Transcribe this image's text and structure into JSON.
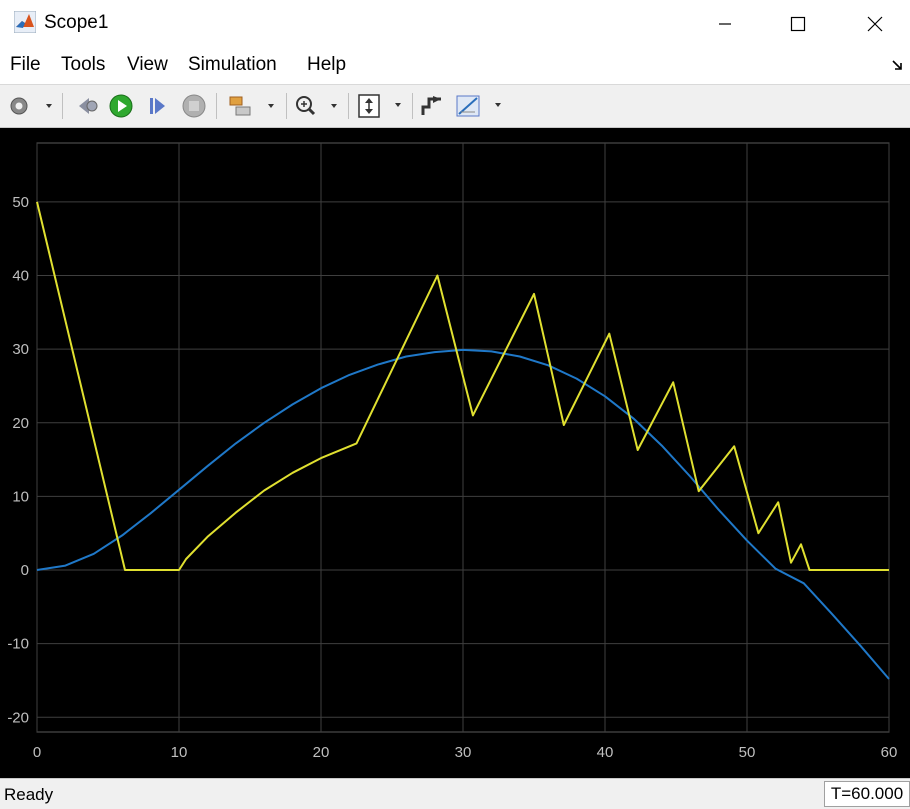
{
  "window": {
    "title": "Scope1"
  },
  "menu": {
    "file": "File",
    "tools": "Tools",
    "view": "View",
    "simulation": "Simulation",
    "help": "Help"
  },
  "toolbar": {
    "icons": [
      "gear-icon",
      "step-back-icon",
      "run-icon",
      "step-forward-icon",
      "stop-icon",
      "layout-icon",
      "zoom-icon",
      "fit-axes-icon",
      "triggers-icon",
      "measure-icon"
    ]
  },
  "status": {
    "text": "Ready",
    "time": "T=60.000"
  },
  "colors": {
    "plot_bg": "#000000",
    "grid": "#3f3f3f",
    "axis_text": "#bfbfbf",
    "series_blue": "#1f78c8",
    "series_yellow": "#e0e030"
  },
  "chart_data": {
    "type": "line",
    "xlim": [
      0,
      60
    ],
    "ylim": [
      -22,
      58
    ],
    "xticks": [
      0,
      10,
      20,
      30,
      40,
      50,
      60
    ],
    "yticks": [
      -20,
      -10,
      0,
      10,
      20,
      30,
      40,
      50
    ],
    "grid": true,
    "series": [
      {
        "color": "#1f78c8",
        "x": [
          0,
          2,
          4,
          6,
          8,
          10,
          12,
          14,
          16,
          18,
          20,
          22,
          24,
          26,
          28,
          30,
          32,
          34,
          36,
          38,
          40,
          42,
          44,
          46,
          48,
          50,
          52,
          54,
          56,
          58,
          60
        ],
        "y": [
          0,
          0.6,
          2.2,
          4.7,
          7.7,
          10.9,
          14.1,
          17.2,
          20.0,
          22.5,
          24.7,
          26.5,
          27.9,
          29.0,
          29.6,
          29.9,
          29.7,
          29.0,
          27.8,
          26.0,
          23.6,
          20.6,
          16.9,
          12.7,
          8.2,
          4.0,
          0.2,
          -1.8,
          -6.0,
          -10.3,
          -14.8
        ]
      },
      {
        "color": "#e0e030",
        "x": [
          0,
          6.2,
          10,
          10.5,
          12,
          14,
          16,
          18,
          20,
          22.5,
          28.2,
          30.7,
          35,
          37.1,
          40.3,
          42.3,
          44.8,
          46.6,
          49.1,
          50.8,
          52.2,
          53.1,
          53.8,
          54.4,
          60
        ],
        "y": [
          50,
          0,
          0,
          1.5,
          4.5,
          7.8,
          10.8,
          13.2,
          15.2,
          17.2,
          40,
          21,
          37.5,
          19.7,
          32.1,
          16.3,
          25.5,
          10.7,
          16.8,
          5,
          9.2,
          1,
          3.5,
          0,
          0
        ]
      }
    ]
  }
}
